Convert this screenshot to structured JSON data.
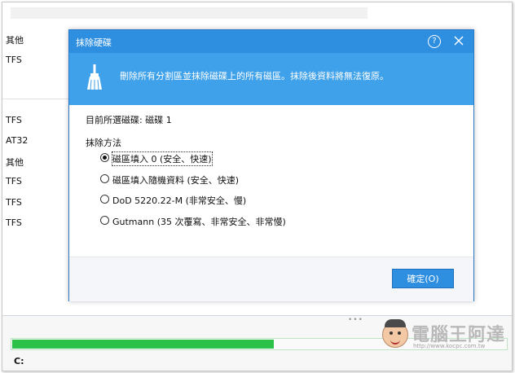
{
  "background": {
    "partition_types": [
      "其他",
      "TFS",
      "TFS",
      "AT32",
      "其他",
      "TFS",
      "TFS",
      "TFS"
    ],
    "progress_fraction": 0.53,
    "drive_label": "C:"
  },
  "dialog": {
    "title": "抹除硬碟",
    "help_symbol": "?",
    "banner_text": "刪除所有分割區並抹除磁碟上的所有磁區。抹除後資料將無法復原。",
    "selected_disk": "目前所選磁碟: 磁碟 1",
    "method_label": "抹除方法",
    "methods": [
      {
        "label": "磁區填入 0 (安全、快速)",
        "selected": true
      },
      {
        "label": "磁區填入隨機資料 (安全、快速)",
        "selected": false
      },
      {
        "label": "DoD 5220.22-M (非常安全、慢)",
        "selected": false
      },
      {
        "label": "Gutmann (35 次覆寫、非常安全、非常慢)",
        "selected": false
      }
    ],
    "ok_label": "確定(O)"
  },
  "watermark": {
    "title": "電腦王阿達",
    "url": "http://www.kocpc.com.tw"
  },
  "colors": {
    "title_bar": "#2e8ee0",
    "banner": "#3fa1ea",
    "progress": "#2cc24a"
  }
}
